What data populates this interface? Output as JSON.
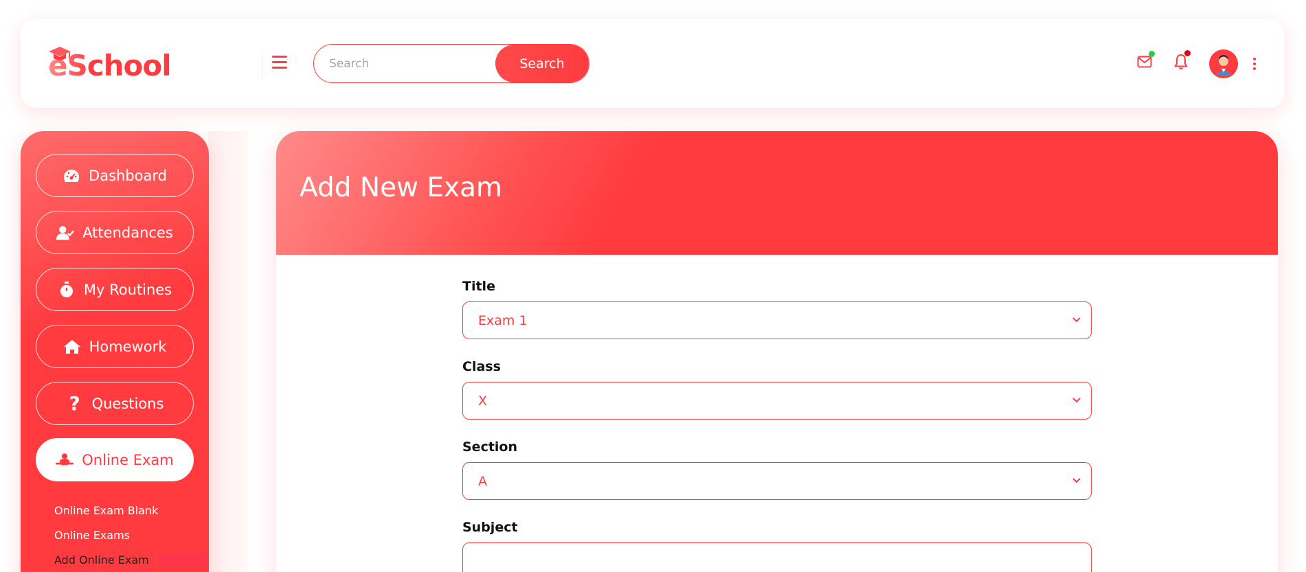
{
  "header": {
    "logo_text": "eSchool",
    "search": {
      "placeholder": "Search",
      "button_label": "Search"
    },
    "indicators": {
      "mail_dot_color": "#2ecc40",
      "bell_dot_color": "#e0001b"
    },
    "icons": [
      "menu-icon",
      "mail-icon",
      "bell-icon",
      "avatar",
      "more-vertical-icon"
    ]
  },
  "sidebar": {
    "items": [
      {
        "label": "Dashboard",
        "icon": "dashboard-gauge-icon"
      },
      {
        "label": "Attendances",
        "icon": "user-check-icon"
      },
      {
        "label": "My Routines",
        "icon": "stopwatch-icon"
      },
      {
        "label": "Homework",
        "icon": "home-icon"
      },
      {
        "label": "Questions",
        "icon": "question-icon"
      },
      {
        "label": "Online Exam",
        "icon": "online-exam-icon",
        "active": true
      }
    ],
    "subitems": [
      {
        "label": "Online Exam Blank"
      },
      {
        "label": "Online Exams"
      },
      {
        "label": "Add Online Exam",
        "current": true
      }
    ]
  },
  "main": {
    "title": "Add New Exam",
    "form": {
      "fields": [
        {
          "label": "Title",
          "value": "Exam 1"
        },
        {
          "label": "Class",
          "value": "X"
        },
        {
          "label": "Section",
          "value": "A"
        },
        {
          "label": "Subject",
          "value": ""
        }
      ]
    }
  },
  "colors": {
    "accent": "#ff3b3f",
    "accent_light": "#ff8a8a",
    "text_dark": "#111111"
  }
}
